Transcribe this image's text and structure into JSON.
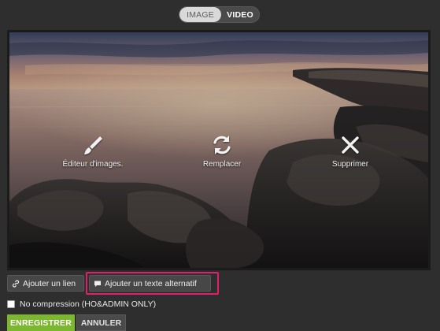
{
  "media_toggle": {
    "image_label": "IMAGE",
    "video_label": "VIDEO",
    "selected": "IMAGE"
  },
  "image_overlay": {
    "edit_label": "Éditeur d'images.",
    "edit_icon": "brush-icon",
    "replace_label": "Remplacer",
    "replace_icon": "refresh-icon",
    "delete_label": "Supprimer",
    "delete_icon": "close-icon"
  },
  "actions": {
    "add_link_label": "Ajouter un lien",
    "add_link_icon": "link-icon",
    "add_alt_label": "Ajouter un texte alternatif",
    "add_alt_icon": "comment-icon",
    "highlight_color": "#e0206a"
  },
  "options": {
    "no_compression_label": "No compression (HO&ADMIN ONLY)",
    "no_compression_checked": false
  },
  "footer": {
    "save_label": "ENREGISTRER",
    "cancel_label": "ANNULER",
    "save_color": "#7cb82f"
  }
}
